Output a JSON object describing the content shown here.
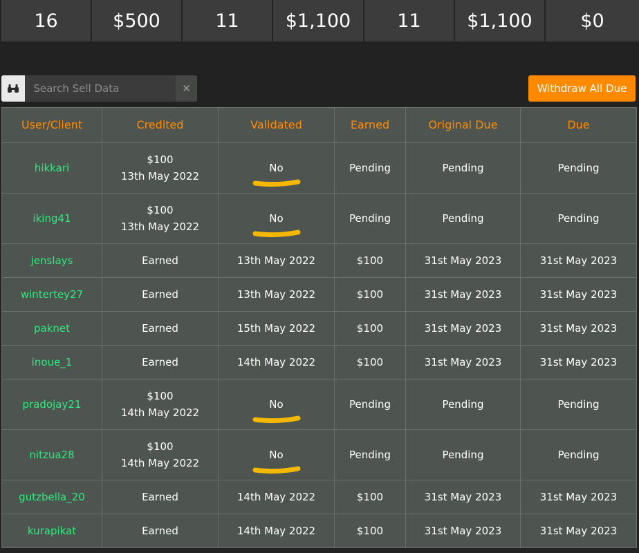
{
  "stats": [
    "16",
    "$500",
    "11",
    "$1,100",
    "11",
    "$1,100",
    "$0"
  ],
  "search": {
    "placeholder": "Search Sell Data",
    "clear_label": "✕",
    "search_icon": "binoculars-icon"
  },
  "actions": {
    "withdraw_label": "Withdraw All Due"
  },
  "table": {
    "headers": [
      "User/Client",
      "Credited",
      "Validated",
      "Earned",
      "Original Due",
      "Due"
    ],
    "rows": [
      {
        "user": "hikkari",
        "credited": "$100",
        "credited_date": "13th May 2022",
        "validated": "No",
        "earned": "Pending",
        "original_due": "Pending",
        "due": "Pending"
      },
      {
        "user": "iking41",
        "credited": "$100",
        "credited_date": "13th May 2022",
        "validated": "No",
        "earned": "Pending",
        "original_due": "Pending",
        "due": "Pending"
      },
      {
        "user": "jenslays",
        "credited": "Earned",
        "credited_date": "",
        "validated": "13th May 2022",
        "earned": "$100",
        "original_due": "31st May 2023",
        "due": "31st May 2023"
      },
      {
        "user": "wintertey27",
        "credited": "Earned",
        "credited_date": "",
        "validated": "13th May 2022",
        "earned": "$100",
        "original_due": "31st May 2023",
        "due": "31st May 2023"
      },
      {
        "user": "paknet",
        "credited": "Earned",
        "credited_date": "",
        "validated": "15th May 2022",
        "earned": "$100",
        "original_due": "31st May 2023",
        "due": "31st May 2023"
      },
      {
        "user": "inoue_1",
        "credited": "Earned",
        "credited_date": "",
        "validated": "14th May 2022",
        "earned": "$100",
        "original_due": "31st May 2023",
        "due": "31st May 2023"
      },
      {
        "user": "pradojay21",
        "credited": "$100",
        "credited_date": "14th May 2022",
        "validated": "No",
        "earned": "Pending",
        "original_due": "Pending",
        "due": "Pending"
      },
      {
        "user": "nitzua28",
        "credited": "$100",
        "credited_date": "14th May 2022",
        "validated": "No",
        "earned": "Pending",
        "original_due": "Pending",
        "due": "Pending"
      },
      {
        "user": "gutzbella_20",
        "credited": "Earned",
        "credited_date": "",
        "validated": "14th May 2022",
        "earned": "$100",
        "original_due": "31st May 2023",
        "due": "31st May 2023"
      },
      {
        "user": "kurapikat",
        "credited": "Earned",
        "credited_date": "",
        "validated": "14th May 2022",
        "earned": "$100",
        "original_due": "31st May 2023",
        "due": "31st May 2023"
      }
    ]
  },
  "colors": {
    "accent": "#ff8a00",
    "user_link": "#2eea7b",
    "highlight_marker": "#f5b800"
  }
}
